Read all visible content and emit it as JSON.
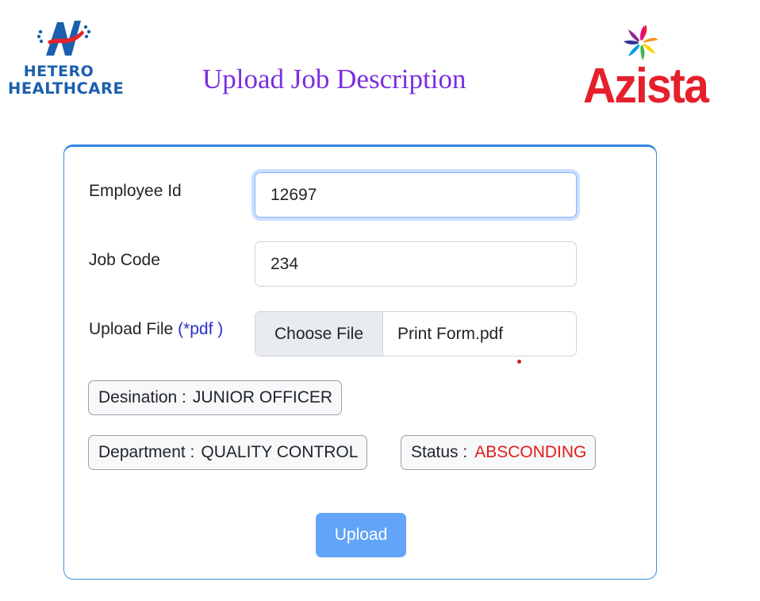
{
  "header": {
    "title": "Upload Job Description",
    "logo_left": {
      "line1": "HETERO",
      "line2": "HEALTHCARE",
      "icon": "hetero-logo-icon"
    },
    "logo_right": {
      "word": "Azista",
      "icon": "azista-pinwheel-icon"
    }
  },
  "form": {
    "employee_id": {
      "label": "Employee Id",
      "value": "12697"
    },
    "job_code": {
      "label": "Job Code",
      "value": "234"
    },
    "upload_file": {
      "label": "Upload File",
      "hint": "(*pdf )",
      "button": "Choose File",
      "filename": "Print Form.pdf"
    }
  },
  "info": {
    "designation": {
      "label": "Desination :",
      "value": "JUNIOR OFFICER"
    },
    "department": {
      "label": "Department :",
      "value": "QUALITY CONTROL"
    },
    "status": {
      "label": "Status :",
      "value": "ABSCONDING"
    }
  },
  "actions": {
    "upload_label": "Upload"
  },
  "colors": {
    "title": "#7a2ee0",
    "card_border": "#2f86e0",
    "upload_button": "#62a4f7",
    "status_value": "#e31b1b",
    "hint": "#2431c7",
    "azista_red": "#e5202b",
    "hetero_blue": "#1b5fae"
  }
}
